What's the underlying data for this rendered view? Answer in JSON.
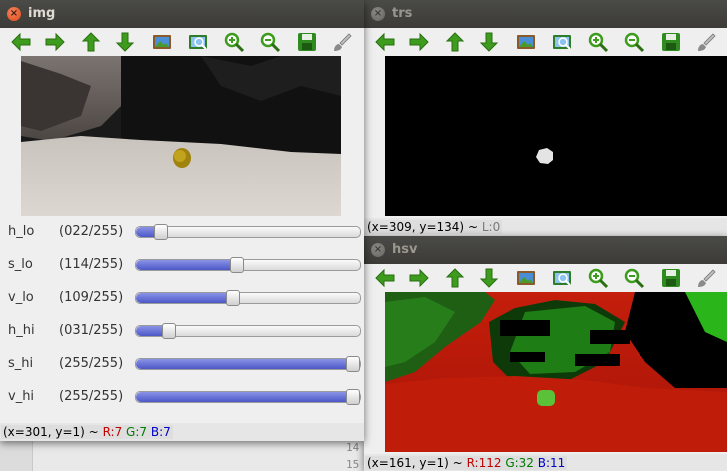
{
  "windows": {
    "img": {
      "title": "img",
      "status": {
        "coords": "(x=301, y=1)",
        "sep": "~",
        "r": "R:7",
        "g": "G:7",
        "b": "B:7"
      },
      "trackbars": [
        {
          "name": "h_lo",
          "value_text": "(022/255)",
          "value": 22,
          "max": 255
        },
        {
          "name": "s_lo",
          "value_text": "(114/255)",
          "value": 114,
          "max": 255
        },
        {
          "name": "v_lo",
          "value_text": "(109/255)",
          "value": 109,
          "max": 255
        },
        {
          "name": "h_hi",
          "value_text": "(031/255)",
          "value": 31,
          "max": 255
        },
        {
          "name": "s_hi",
          "value_text": "(255/255)",
          "value": 255,
          "max": 255
        },
        {
          "name": "v_hi",
          "value_text": "(255/255)",
          "value": 255,
          "max": 255
        }
      ]
    },
    "trs": {
      "title": "trs",
      "status": {
        "coords": "(x=309, y=134)",
        "sep": "~",
        "l": "L:0"
      }
    },
    "hsv": {
      "title": "hsv",
      "status": {
        "coords": "(x=161, y=1)",
        "sep": "~",
        "r": "R:112",
        "g": "G:32",
        "b": "B:11"
      }
    }
  },
  "background": {
    "line_numbers": [
      "14",
      "15"
    ]
  },
  "toolbar_icons": [
    "pan-left-icon",
    "pan-right-icon",
    "pan-up-icon",
    "pan-down-icon",
    "zoom-original-icon",
    "zoom-fit-icon",
    "zoom-in-icon",
    "zoom-out-icon",
    "save-icon",
    "properties-brush-icon"
  ],
  "colors": {
    "titlebar": "#3c3b37",
    "close_button": "#e95420",
    "trackbar_fill": "#5b66d4",
    "arrow_green": "#3d9b1d"
  }
}
